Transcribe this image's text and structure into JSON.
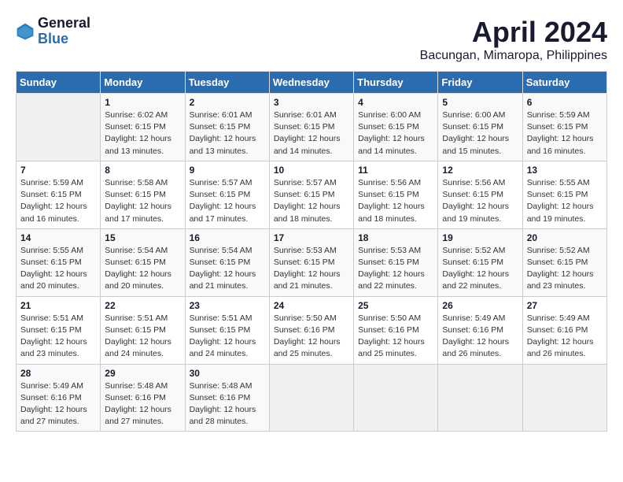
{
  "header": {
    "logo_general": "General",
    "logo_blue": "Blue",
    "month_title": "April 2024",
    "location": "Bacungan, Mimaropa, Philippines"
  },
  "weekdays": [
    "Sunday",
    "Monday",
    "Tuesday",
    "Wednesday",
    "Thursday",
    "Friday",
    "Saturday"
  ],
  "weeks": [
    [
      {
        "day": "",
        "sunrise": "",
        "sunset": "",
        "daylight": ""
      },
      {
        "day": "1",
        "sunrise": "Sunrise: 6:02 AM",
        "sunset": "Sunset: 6:15 PM",
        "daylight": "Daylight: 12 hours and 13 minutes."
      },
      {
        "day": "2",
        "sunrise": "Sunrise: 6:01 AM",
        "sunset": "Sunset: 6:15 PM",
        "daylight": "Daylight: 12 hours and 13 minutes."
      },
      {
        "day": "3",
        "sunrise": "Sunrise: 6:01 AM",
        "sunset": "Sunset: 6:15 PM",
        "daylight": "Daylight: 12 hours and 14 minutes."
      },
      {
        "day": "4",
        "sunrise": "Sunrise: 6:00 AM",
        "sunset": "Sunset: 6:15 PM",
        "daylight": "Daylight: 12 hours and 14 minutes."
      },
      {
        "day": "5",
        "sunrise": "Sunrise: 6:00 AM",
        "sunset": "Sunset: 6:15 PM",
        "daylight": "Daylight: 12 hours and 15 minutes."
      },
      {
        "day": "6",
        "sunrise": "Sunrise: 5:59 AM",
        "sunset": "Sunset: 6:15 PM",
        "daylight": "Daylight: 12 hours and 16 minutes."
      }
    ],
    [
      {
        "day": "7",
        "sunrise": "Sunrise: 5:59 AM",
        "sunset": "Sunset: 6:15 PM",
        "daylight": "Daylight: 12 hours and 16 minutes."
      },
      {
        "day": "8",
        "sunrise": "Sunrise: 5:58 AM",
        "sunset": "Sunset: 6:15 PM",
        "daylight": "Daylight: 12 hours and 17 minutes."
      },
      {
        "day": "9",
        "sunrise": "Sunrise: 5:57 AM",
        "sunset": "Sunset: 6:15 PM",
        "daylight": "Daylight: 12 hours and 17 minutes."
      },
      {
        "day": "10",
        "sunrise": "Sunrise: 5:57 AM",
        "sunset": "Sunset: 6:15 PM",
        "daylight": "Daylight: 12 hours and 18 minutes."
      },
      {
        "day": "11",
        "sunrise": "Sunrise: 5:56 AM",
        "sunset": "Sunset: 6:15 PM",
        "daylight": "Daylight: 12 hours and 18 minutes."
      },
      {
        "day": "12",
        "sunrise": "Sunrise: 5:56 AM",
        "sunset": "Sunset: 6:15 PM",
        "daylight": "Daylight: 12 hours and 19 minutes."
      },
      {
        "day": "13",
        "sunrise": "Sunrise: 5:55 AM",
        "sunset": "Sunset: 6:15 PM",
        "daylight": "Daylight: 12 hours and 19 minutes."
      }
    ],
    [
      {
        "day": "14",
        "sunrise": "Sunrise: 5:55 AM",
        "sunset": "Sunset: 6:15 PM",
        "daylight": "Daylight: 12 hours and 20 minutes."
      },
      {
        "day": "15",
        "sunrise": "Sunrise: 5:54 AM",
        "sunset": "Sunset: 6:15 PM",
        "daylight": "Daylight: 12 hours and 20 minutes."
      },
      {
        "day": "16",
        "sunrise": "Sunrise: 5:54 AM",
        "sunset": "Sunset: 6:15 PM",
        "daylight": "Daylight: 12 hours and 21 minutes."
      },
      {
        "day": "17",
        "sunrise": "Sunrise: 5:53 AM",
        "sunset": "Sunset: 6:15 PM",
        "daylight": "Daylight: 12 hours and 21 minutes."
      },
      {
        "day": "18",
        "sunrise": "Sunrise: 5:53 AM",
        "sunset": "Sunset: 6:15 PM",
        "daylight": "Daylight: 12 hours and 22 minutes."
      },
      {
        "day": "19",
        "sunrise": "Sunrise: 5:52 AM",
        "sunset": "Sunset: 6:15 PM",
        "daylight": "Daylight: 12 hours and 22 minutes."
      },
      {
        "day": "20",
        "sunrise": "Sunrise: 5:52 AM",
        "sunset": "Sunset: 6:15 PM",
        "daylight": "Daylight: 12 hours and 23 minutes."
      }
    ],
    [
      {
        "day": "21",
        "sunrise": "Sunrise: 5:51 AM",
        "sunset": "Sunset: 6:15 PM",
        "daylight": "Daylight: 12 hours and 23 minutes."
      },
      {
        "day": "22",
        "sunrise": "Sunrise: 5:51 AM",
        "sunset": "Sunset: 6:15 PM",
        "daylight": "Daylight: 12 hours and 24 minutes."
      },
      {
        "day": "23",
        "sunrise": "Sunrise: 5:51 AM",
        "sunset": "Sunset: 6:15 PM",
        "daylight": "Daylight: 12 hours and 24 minutes."
      },
      {
        "day": "24",
        "sunrise": "Sunrise: 5:50 AM",
        "sunset": "Sunset: 6:16 PM",
        "daylight": "Daylight: 12 hours and 25 minutes."
      },
      {
        "day": "25",
        "sunrise": "Sunrise: 5:50 AM",
        "sunset": "Sunset: 6:16 PM",
        "daylight": "Daylight: 12 hours and 25 minutes."
      },
      {
        "day": "26",
        "sunrise": "Sunrise: 5:49 AM",
        "sunset": "Sunset: 6:16 PM",
        "daylight": "Daylight: 12 hours and 26 minutes."
      },
      {
        "day": "27",
        "sunrise": "Sunrise: 5:49 AM",
        "sunset": "Sunset: 6:16 PM",
        "daylight": "Daylight: 12 hours and 26 minutes."
      }
    ],
    [
      {
        "day": "28",
        "sunrise": "Sunrise: 5:49 AM",
        "sunset": "Sunset: 6:16 PM",
        "daylight": "Daylight: 12 hours and 27 minutes."
      },
      {
        "day": "29",
        "sunrise": "Sunrise: 5:48 AM",
        "sunset": "Sunset: 6:16 PM",
        "daylight": "Daylight: 12 hours and 27 minutes."
      },
      {
        "day": "30",
        "sunrise": "Sunrise: 5:48 AM",
        "sunset": "Sunset: 6:16 PM",
        "daylight": "Daylight: 12 hours and 28 minutes."
      },
      {
        "day": "",
        "sunrise": "",
        "sunset": "",
        "daylight": ""
      },
      {
        "day": "",
        "sunrise": "",
        "sunset": "",
        "daylight": ""
      },
      {
        "day": "",
        "sunrise": "",
        "sunset": "",
        "daylight": ""
      },
      {
        "day": "",
        "sunrise": "",
        "sunset": "",
        "daylight": ""
      }
    ]
  ]
}
